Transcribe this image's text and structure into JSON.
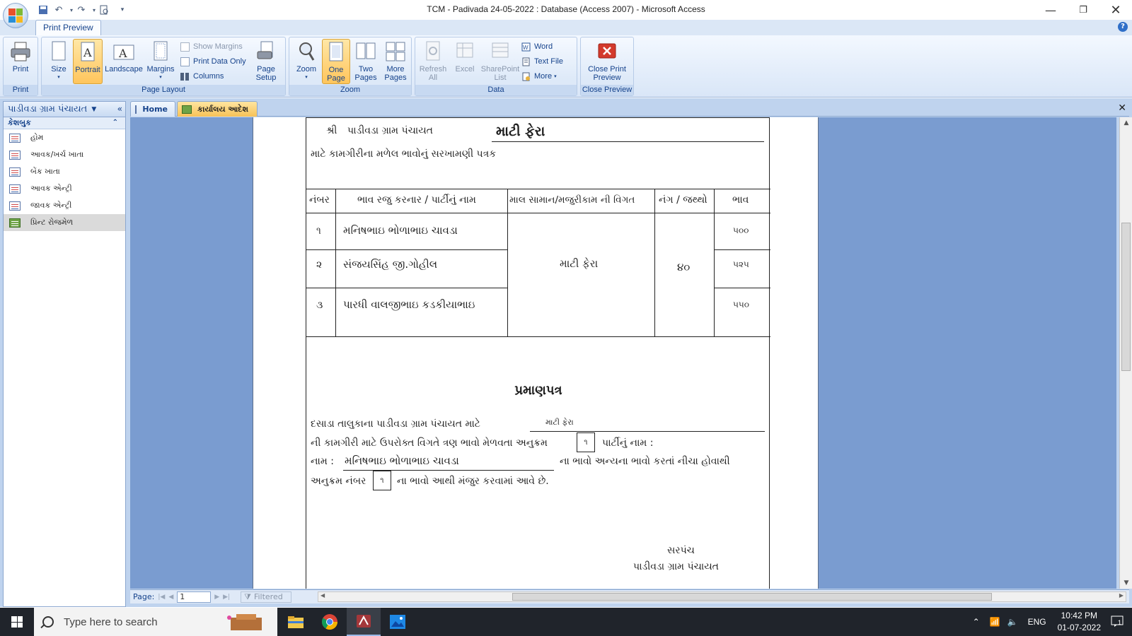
{
  "window": {
    "title": "TCM - Padivada 24-05-2022 : Database (Access 2007) - Microsoft Access"
  },
  "ribbon": {
    "tab": "Print Preview",
    "groups": {
      "print": {
        "label": "Print",
        "print_label": "Print"
      },
      "page_layout": {
        "label": "Page Layout",
        "size": "Size",
        "portrait": "Portrait",
        "landscape": "Landscape",
        "margins": "Margins",
        "show_margins": "Show Margins",
        "print_data_only": "Print Data Only",
        "columns": "Columns",
        "page_setup": "Page Setup"
      },
      "zoom": {
        "label": "Zoom",
        "zoom": "Zoom",
        "one_page": "One Page",
        "two_pages": "Two Pages",
        "more_pages": "More Pages"
      },
      "data": {
        "label": "Data",
        "refresh_all": "Refresh All",
        "excel": "Excel",
        "sharepoint_list": "SharePoint List",
        "word": "Word",
        "text_file": "Text File",
        "more": "More"
      },
      "close_preview": {
        "label": "Close Preview",
        "close_print_preview": "Close Print Preview"
      }
    }
  },
  "nav": {
    "header": "પાડીવડા ગ્રામ પંચાયત",
    "group": "કેશબુક",
    "items": [
      {
        "label": "હોમ",
        "type": "form"
      },
      {
        "label": "આવક/ખર્ચ ખાતા",
        "type": "form"
      },
      {
        "label": "બેંક ખાતા",
        "type": "form"
      },
      {
        "label": "આવક એન્ટ્રી",
        "type": "form"
      },
      {
        "label": "જાવક એન્ટ્રી",
        "type": "form"
      },
      {
        "label": "પ્રિન્ટ રોજમેળ",
        "type": "report"
      }
    ]
  },
  "doc_tabs": [
    {
      "label": "Home"
    },
    {
      "label": "કાર્યાલય આદેશ"
    }
  ],
  "report": {
    "shri": "શ્રી",
    "org": "પાડીવડા ગ્રામ પંચાયત",
    "work": "માટી ફેરા",
    "subtitle": "માટે કામગીરીના મળેલ ભાવોનું સરખામણી પત્રક",
    "table": {
      "headers": [
        "નંબર",
        "ભાવ રજુ કરનાર / પાર્ટીનું નામ",
        "માલ સામાન/મજુરીકામ ની વિગત",
        "નંગ / જથ્થો",
        "ભાવ"
      ],
      "rows": [
        {
          "no": "૧",
          "name": "મનિષભાઇ ભોળાભાઇ ચાવડા",
          "rate": "૫૦૦"
        },
        {
          "no": "૨",
          "name": "સંજયસિંહ જી.ગોહીલ",
          "rate": "૫૨૫"
        },
        {
          "no": "૩",
          "name": "પારધી વાલજીભાઇ કડકીયાભાઇ",
          "rate": "૫૫૦"
        }
      ],
      "detail": "માટી ફેરા",
      "quantity": "૪૦"
    },
    "certificate": {
      "title": "પ્રમાણપત્ર",
      "line1": "દસાડા તાલુકાના પાડીવડા ગ્રામ પંચાયત માટે",
      "work": "માટી ફેરા",
      "line2": "ની કામગીરી માટે ઉપરોક્ત વિગતે ત્રણ ભાવો મેળવતા અનુક્રમ",
      "serial_box": "૧",
      "party_name_label": "પાર્ટીનું  નામ :",
      "name_label": "નામ :",
      "name_value": "મનિષભાઇ ભોળાભાઇ ચાવડા",
      "line3_end": "ના ભાવો અન્યના ભાવો કરતાં નીચા હોવાથી",
      "serial_label": "અનુક્રમ નંબર",
      "serial_value": "૧",
      "line4_end": "ના ભાવો આથી મંજુર કરવામાં આવે છે."
    },
    "signature": {
      "role": "સરપંચ",
      "org": "પાડીવડા ગ્રામ પંચાયત"
    }
  },
  "status": {
    "page_label": "Page:",
    "page_value": "1",
    "filter": "Filtered"
  },
  "taskbar": {
    "search_placeholder": "Type here to search",
    "lang": "ENG",
    "time": "10:42 PM",
    "date": "01-07-2022",
    "notifications": "1"
  }
}
